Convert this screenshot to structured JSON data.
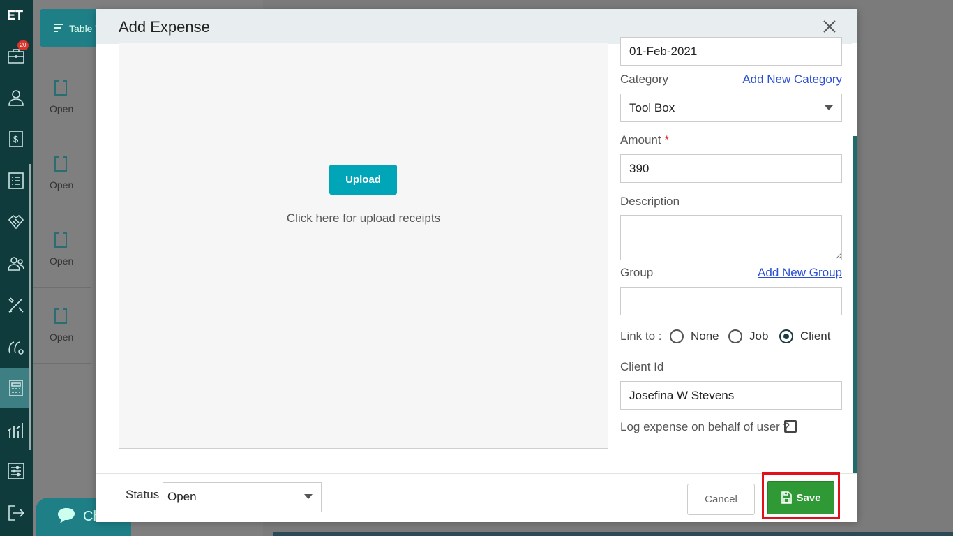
{
  "sidebar": {
    "logo": "ET",
    "badge_count": "20",
    "icons": [
      "briefcase-icon",
      "user-icon",
      "dollar-icon",
      "list-icon",
      "handshake-icon",
      "users-icon",
      "tools-icon",
      "chat-bubble-icon",
      "calculator-icon",
      "chart-icon",
      "settings-sliders-icon",
      "logout-icon"
    ]
  },
  "background": {
    "table_view_label": "Table V",
    "row_status": [
      "Open",
      "Open",
      "Open",
      "Open"
    ],
    "chat_label": "Ch"
  },
  "modal": {
    "title": "Add Expense",
    "upload": {
      "button_label": "Upload",
      "hint": "Click here for upload receipts"
    },
    "date_value": "01-Feb-2021",
    "category": {
      "label": "Category",
      "add_link": "Add New Category",
      "value": "Tool Box"
    },
    "amount": {
      "label": "Amount",
      "required_mark": "*",
      "value": "390"
    },
    "description": {
      "label": "Description",
      "value": ""
    },
    "group": {
      "label": "Group",
      "add_link": "Add New Group",
      "value": ""
    },
    "link_to": {
      "label": "Link to :",
      "options": [
        "None",
        "Job",
        "Client"
      ],
      "selected": "Client"
    },
    "client_id": {
      "label": "Client Id",
      "value": "Josefina W Stevens"
    },
    "log_behalf": {
      "label": "Log expense on behalf of user ?",
      "checked": false
    },
    "footer": {
      "status_label": "Status",
      "status_value": "Open",
      "cancel_label": "Cancel",
      "save_label": "Save"
    }
  },
  "colors": {
    "sidebar_bg": "#0f3b3d",
    "accent_teal": "#00a5b8",
    "save_green": "#2f9a35",
    "highlight_red": "#e0111b",
    "link_blue": "#2a4fd0"
  }
}
